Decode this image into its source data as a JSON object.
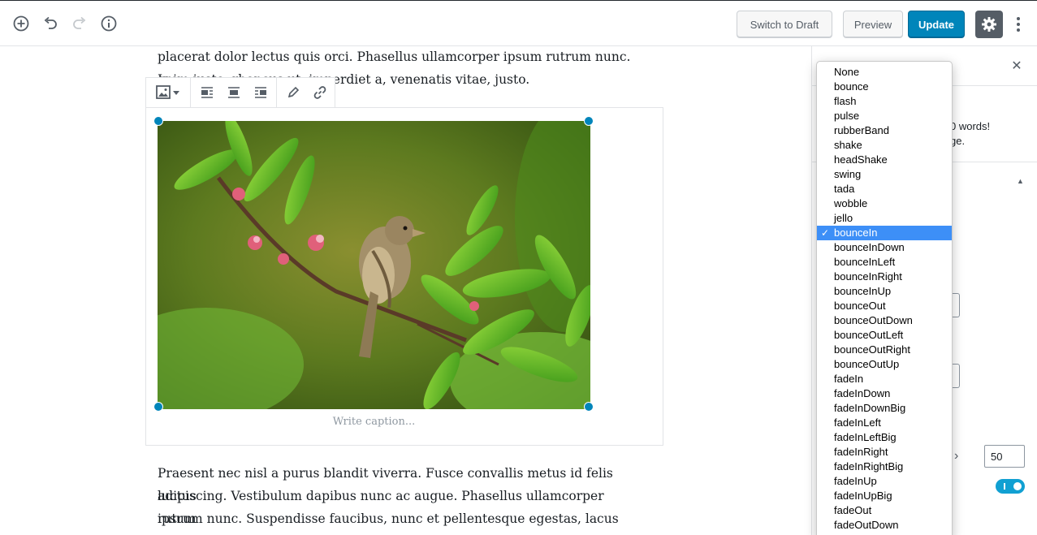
{
  "toolbar": {
    "switch_label": "Switch to Draft",
    "preview_label": "Preview",
    "update_label": "Update"
  },
  "editor": {
    "paragraph1_line1": "placerat dolor lectus quis orci. Phasellus ullamcorper ipsum rutrum nunc. In",
    "paragraph1_line2": "enim justo, rhoncus ut, imperdiet a, venenatis vitae, justo.",
    "caption_placeholder": "Write caption...",
    "paragraph2_lines": [
      "Praesent nec nisl a purus blandit viverra. Fusce convallis metus id felis luctus",
      "adipiscing. Vestibulum dapibus nunc ac augue. Phasellus ullamcorper ipsum",
      "rutrum nunc. Suspendisse faucibus, nunc et pellentesque egestas, lacus ante"
    ]
  },
  "sidebar": {
    "close_label": "✕",
    "notice_line1": "0 words!",
    "notice_line2": "ge.",
    "number_value": "50",
    "toggle_on": true
  },
  "dropdown": {
    "selected": "bounceIn",
    "options": [
      "None",
      "bounce",
      "flash",
      "pulse",
      "rubberBand",
      "shake",
      "headShake",
      "swing",
      "tada",
      "wobble",
      "jello",
      "bounceIn",
      "bounceInDown",
      "bounceInLeft",
      "bounceInRight",
      "bounceInUp",
      "bounceOut",
      "bounceOutDown",
      "bounceOutLeft",
      "bounceOutRight",
      "bounceOutUp",
      "fadeIn",
      "fadeInDown",
      "fadeInDownBig",
      "fadeInLeft",
      "fadeInLeftBig",
      "fadeInRight",
      "fadeInRightBig",
      "fadeInUp",
      "fadeInUpBig",
      "fadeOut",
      "fadeOutDown"
    ]
  },
  "colors": {
    "primary": "#0085ba",
    "selection": "#3d8ff7",
    "toggle": "#11a0d2"
  }
}
